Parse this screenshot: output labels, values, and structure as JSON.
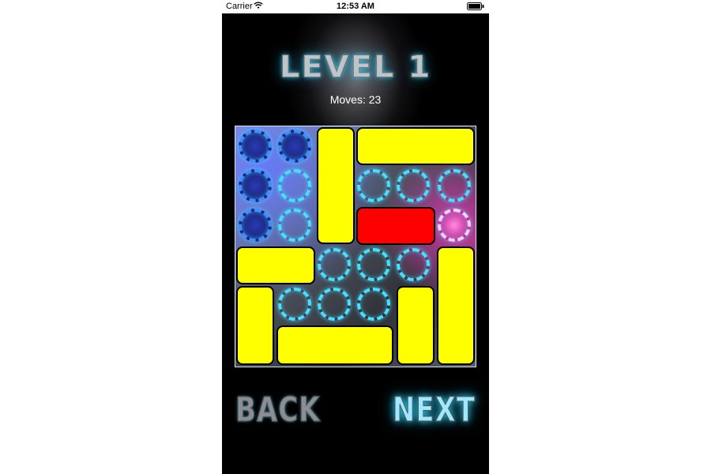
{
  "status_bar": {
    "carrier": "Carrier",
    "time": "12:53 AM"
  },
  "level": {
    "title": "LEVEL 1",
    "moves_label": "Moves:",
    "moves_value": "23"
  },
  "board": {
    "colors": {
      "block": "#ffff00",
      "target_block": "#ff0000",
      "ring": "#45e0ff"
    }
  },
  "nav": {
    "back_label": "BACK",
    "next_label": "NEXT"
  }
}
